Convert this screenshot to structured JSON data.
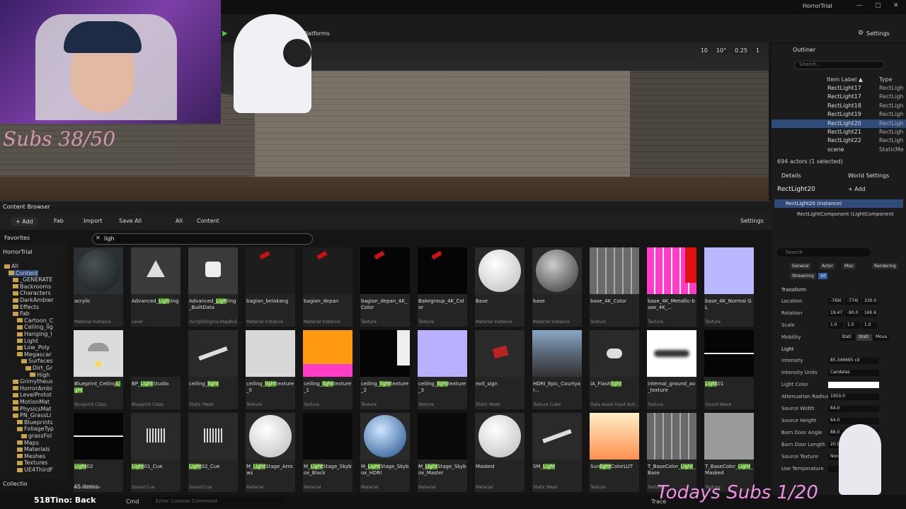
{
  "window": {
    "title": "HorrorTrial",
    "min": "—",
    "max": "▢",
    "close": "✕"
  },
  "toolbar": {
    "platforms": "Platforms",
    "settings": "Settings"
  },
  "viewport": {
    "tools": [
      "10",
      "10°",
      "0.25",
      "1"
    ],
    "overlay_text": "Subs 38/50"
  },
  "content_browser": {
    "tab": "Content Browser",
    "add": "+ Add",
    "fab": "Fab",
    "import": "Import",
    "save_all": "Save All",
    "path": [
      "All",
      "Content"
    ],
    "settings": "Settings",
    "search_value": "ligh",
    "favorites": "Favorites",
    "project": "HorrorTrial",
    "item_count": "45 items",
    "collections": "Collectio"
  },
  "tree": [
    {
      "label": "All",
      "indent": 0
    },
    {
      "label": "Content",
      "indent": 1
    },
    {
      "label": "_GENERATE",
      "indent": 2
    },
    {
      "label": "Backrooms",
      "indent": 2
    },
    {
      "label": "Characters",
      "indent": 2
    },
    {
      "label": "DarkAmbier",
      "indent": 2
    },
    {
      "label": "Effects",
      "indent": 2
    },
    {
      "label": "Fab",
      "indent": 2
    },
    {
      "label": "Cartoon_C",
      "indent": 3
    },
    {
      "label": "Ceiling_lig",
      "indent": 3
    },
    {
      "label": "Hanging_l",
      "indent": 3
    },
    {
      "label": "Light",
      "indent": 3
    },
    {
      "label": "Low_Poly",
      "indent": 3
    },
    {
      "label": "Megascar",
      "indent": 3
    },
    {
      "label": "Surfaces",
      "indent": 4
    },
    {
      "label": "Dirt_Gr",
      "indent": 5
    },
    {
      "label": "High",
      "indent": 6
    },
    {
      "label": "Grimytheus",
      "indent": 2
    },
    {
      "label": "HorrorAmbi",
      "indent": 2
    },
    {
      "label": "LevelProtot",
      "indent": 2
    },
    {
      "label": "MotionMat",
      "indent": 2
    },
    {
      "label": "PhysicsMat",
      "indent": 2
    },
    {
      "label": "PN_GrassLi",
      "indent": 2
    },
    {
      "label": "Blueprints",
      "indent": 3
    },
    {
      "label": "FoliageTyp",
      "indent": 3
    },
    {
      "label": "grassFol",
      "indent": 4
    },
    {
      "label": "Maps",
      "indent": 3
    },
    {
      "label": "Materials",
      "indent": 3
    },
    {
      "label": "Meshes",
      "indent": 3
    },
    {
      "label": "Textures",
      "indent": 3
    },
    {
      "label": "UE4ThirdF",
      "indent": 3
    }
  ],
  "assets": [
    {
      "pre": "acrylic",
      "hl": "",
      "post": "",
      "type": "Material Instance",
      "thumb": "#2a3033",
      "shape": "sphere-dark"
    },
    {
      "pre": "Advanced_",
      "hl": "Ligh",
      "post": "ting",
      "type": "Level",
      "thumb": "#3a3a3a",
      "shape": "level"
    },
    {
      "pre": "Advanced_",
      "hl": "Ligh",
      "post": "ting_BuiltData",
      "type": "/Script/Engine.MapBuil...",
      "thumb": "#3a3a3a",
      "shape": "cube"
    },
    {
      "pre": "bagian_belakang",
      "hl": "",
      "post": "",
      "type": "Material Instance",
      "thumb": "#1d1d1d",
      "shape": "red-mark"
    },
    {
      "pre": "bagian_depan",
      "hl": "",
      "post": "",
      "type": "Material Instance",
      "thumb": "#1d1d1d",
      "shape": "red-mark"
    },
    {
      "pre": "bagian_depan_4K_Color",
      "hl": "",
      "post": "",
      "type": "Texture",
      "thumb": "#050505",
      "shape": "red-mark"
    },
    {
      "pre": "Bakegroup_4K_Color",
      "hl": "",
      "post": "",
      "type": "Texture",
      "thumb": "#050505",
      "shape": "red-mark"
    },
    {
      "pre": "Base",
      "hl": "",
      "post": "",
      "type": "Material Instance",
      "thumb": "#2a2a2a",
      "shape": "sphere-white"
    },
    {
      "pre": "base",
      "hl": "",
      "post": "",
      "type": "Material Instance",
      "thumb": "#2a2a2a",
      "shape": "sphere-grey"
    },
    {
      "pre": "base_4K_Color",
      "hl": "",
      "post": "",
      "type": "Texture",
      "thumb": "#8a8a8a",
      "shape": "stripes-grey"
    },
    {
      "pre": "base_4K_Metallic-base_4K_...",
      "hl": "",
      "post": "",
      "type": "Texture",
      "thumb": "#ff40c8",
      "shape": "stripes-pink"
    },
    {
      "pre": "base_4K_Normal GL",
      "hl": "",
      "post": "",
      "type": "Texture",
      "thumb": "#b9b8ff",
      "shape": "flat"
    },
    {
      "pre": "Blueprint_Ceiling",
      "hl": "Light",
      "post": "",
      "type": "Blueprint Class",
      "thumb": "#dcdcdc",
      "shape": "lamp"
    },
    {
      "pre": "BP_",
      "hl": "Light",
      "post": "Studio",
      "type": "Blueprint Class",
      "thumb": "#151515",
      "shape": "flat"
    },
    {
      "pre": "ceiling_",
      "hl": "light",
      "post": "",
      "type": "Static Mesh",
      "thumb": "#2a2a2a",
      "shape": "bar"
    },
    {
      "pre": "ceiling_",
      "hl": "light",
      "post": "texture_0",
      "type": "Texture",
      "thumb": "#d8d8d8",
      "shape": "flat"
    },
    {
      "pre": "ceiling_",
      "hl": "light",
      "post": "texture_1",
      "type": "Texture",
      "thumb": "#ff9a10",
      "shape": "orange"
    },
    {
      "pre": "ceiling_",
      "hl": "light",
      "post": "texture_2",
      "type": "Texture",
      "thumb": "#050505",
      "shape": "whiteblock"
    },
    {
      "pre": "ceiling_",
      "hl": "light",
      "post": "texture_3",
      "type": "Texture",
      "thumb": "#b9b0ff",
      "shape": "flat"
    },
    {
      "pre": "exit_sign",
      "hl": "",
      "post": "",
      "type": "Static Mesh",
      "thumb": "#2a2a2a",
      "shape": "exit"
    },
    {
      "pre": "HDRI_Epic_Courtyar...",
      "hl": "",
      "post": "",
      "type": "Texture Cube",
      "thumb": "#556677",
      "shape": "sky"
    },
    {
      "pre": "IA_Flash",
      "hl": "light",
      "post": "",
      "type": "Data Asset Input Acti...",
      "thumb": "#2a2a2a",
      "shape": "gamepad"
    },
    {
      "pre": "internal_ground_ao_texture",
      "hl": "",
      "post": "",
      "type": "Texture",
      "thumb": "#ffffff",
      "shape": "blur"
    },
    {
      "pre": "",
      "hl": "Light",
      "post": "01",
      "type": "Sound Wave",
      "thumb": "#050505",
      "shape": "line"
    },
    {
      "pre": "",
      "hl": "Light",
      "post": "02",
      "type": "Sound Wave",
      "thumb": "#050505",
      "shape": "line"
    },
    {
      "pre": "",
      "hl": "Light",
      "post": "01_Cue",
      "type": "Sound Cue",
      "thumb": "#2a2a2a",
      "shape": "wave"
    },
    {
      "pre": "",
      "hl": "Light",
      "post": "02_Cue",
      "type": "Sound Cue",
      "thumb": "#2a2a2a",
      "shape": "wave"
    },
    {
      "pre": "M_",
      "hl": "Light",
      "post": "Stage_Arrows",
      "type": "Material",
      "thumb": "#2a2a2a",
      "shape": "sphere-white"
    },
    {
      "pre": "M_",
      "hl": "Light",
      "post": "Stage_Skybox_Black",
      "type": "Material",
      "thumb": "#0a0a0a",
      "shape": "flat"
    },
    {
      "pre": "M_",
      "hl": "Light",
      "post": "Stage_Skybox_HDRI",
      "type": "Material",
      "thumb": "#2a2a2a",
      "shape": "sphere-blue"
    },
    {
      "pre": "M_",
      "hl": "Light",
      "post": "Stage_Skybox_Master",
      "type": "Material",
      "thumb": "#0a0a0a",
      "shape": "flat"
    },
    {
      "pre": "Masked",
      "hl": "",
      "post": "",
      "type": "Material",
      "thumb": "#2a2a2a",
      "shape": "sphere-white"
    },
    {
      "pre": "SM_",
      "hl": "Light",
      "post": "",
      "type": "Static Mesh",
      "thumb": "#2a2a2a",
      "shape": "bar"
    },
    {
      "pre": "Sun",
      "hl": "light",
      "post": "ColorLUT",
      "type": "Texture",
      "thumb": "#ffe0b0",
      "shape": "gradient"
    },
    {
      "pre": "T_BaseColor_",
      "hl": "Light",
      "post": "_Base",
      "type": "Texture",
      "thumb": "#8a8a8a",
      "shape": "stripes-grey"
    },
    {
      "pre": "T_BaseColor_",
      "hl": "Light",
      "post": "_Masked",
      "type": "Texture",
      "thumb": "#9a9a9a",
      "shape": "flat"
    }
  ],
  "outliner": {
    "title": "Outliner",
    "search": "Search...",
    "col_label": "Item Label ▲",
    "col_type": "Type",
    "rows": [
      {
        "name": "RectLight17",
        "type": "RectLigh"
      },
      {
        "name": "RectLight17",
        "type": "RectLigh"
      },
      {
        "name": "RectLight18",
        "type": "RectLigh"
      },
      {
        "name": "RectLight19",
        "type": "RectLigh"
      },
      {
        "name": "RectLight20",
        "type": "RectLigh"
      },
      {
        "name": "RectLight21",
        "type": "RectLigh"
      },
      {
        "name": "RectLight22",
        "type": "RectLigh"
      },
      {
        "name": "scene",
        "type": "StaticMe"
      }
    ],
    "count": "694 actors (1 selected)"
  },
  "details": {
    "tab": "Details",
    "world_tab": "World Settings",
    "actor": "RectLight20",
    "add": "+ Add",
    "instance": "RectLight20 (Instance)",
    "component": "RectLightComponent (LightComponent",
    "search": "Search",
    "filters": [
      "General",
      "Actor",
      "Misc",
      "Rendering",
      "Streaming",
      "All"
    ],
    "transform": "Transform",
    "location": [
      "-769(",
      "-774(",
      "330.0"
    ],
    "rotation": [
      "19.47",
      "-90.0",
      "160.6"
    ],
    "scale": [
      "1.0",
      "1.0",
      "1.0"
    ],
    "mobility": [
      "Stati",
      "Stati",
      "Mova"
    ],
    "light_section": "Light",
    "props": [
      {
        "label": "Intensity",
        "value": "85.346695 cd"
      },
      {
        "label": "Intensity Units",
        "value": "Candelas"
      },
      {
        "label": "Light Color",
        "value": ""
      },
      {
        "label": "Attenuation Radius",
        "value": "1950.0"
      },
      {
        "label": "Source Width",
        "value": "64.0"
      },
      {
        "label": "Source Height",
        "value": "64.0"
      },
      {
        "label": "Barn Door Angle",
        "value": "88.0"
      },
      {
        "label": "Barn Door Length",
        "value": "20.0"
      },
      {
        "label": "Source Texture",
        "value": "None"
      },
      {
        "label": "Use Temperature",
        "value": ""
      }
    ],
    "location_label": "Location",
    "rotation_label": "Rotation",
    "scale_label": "Scale",
    "mobility_label": "Mobility"
  },
  "bottom": {
    "back": "518Tino: Back",
    "cmd": "Cmd",
    "console_placeholder": "Enter Console Command",
    "trace": "Trace",
    "today_subs": "Todays Subs 1/20"
  }
}
